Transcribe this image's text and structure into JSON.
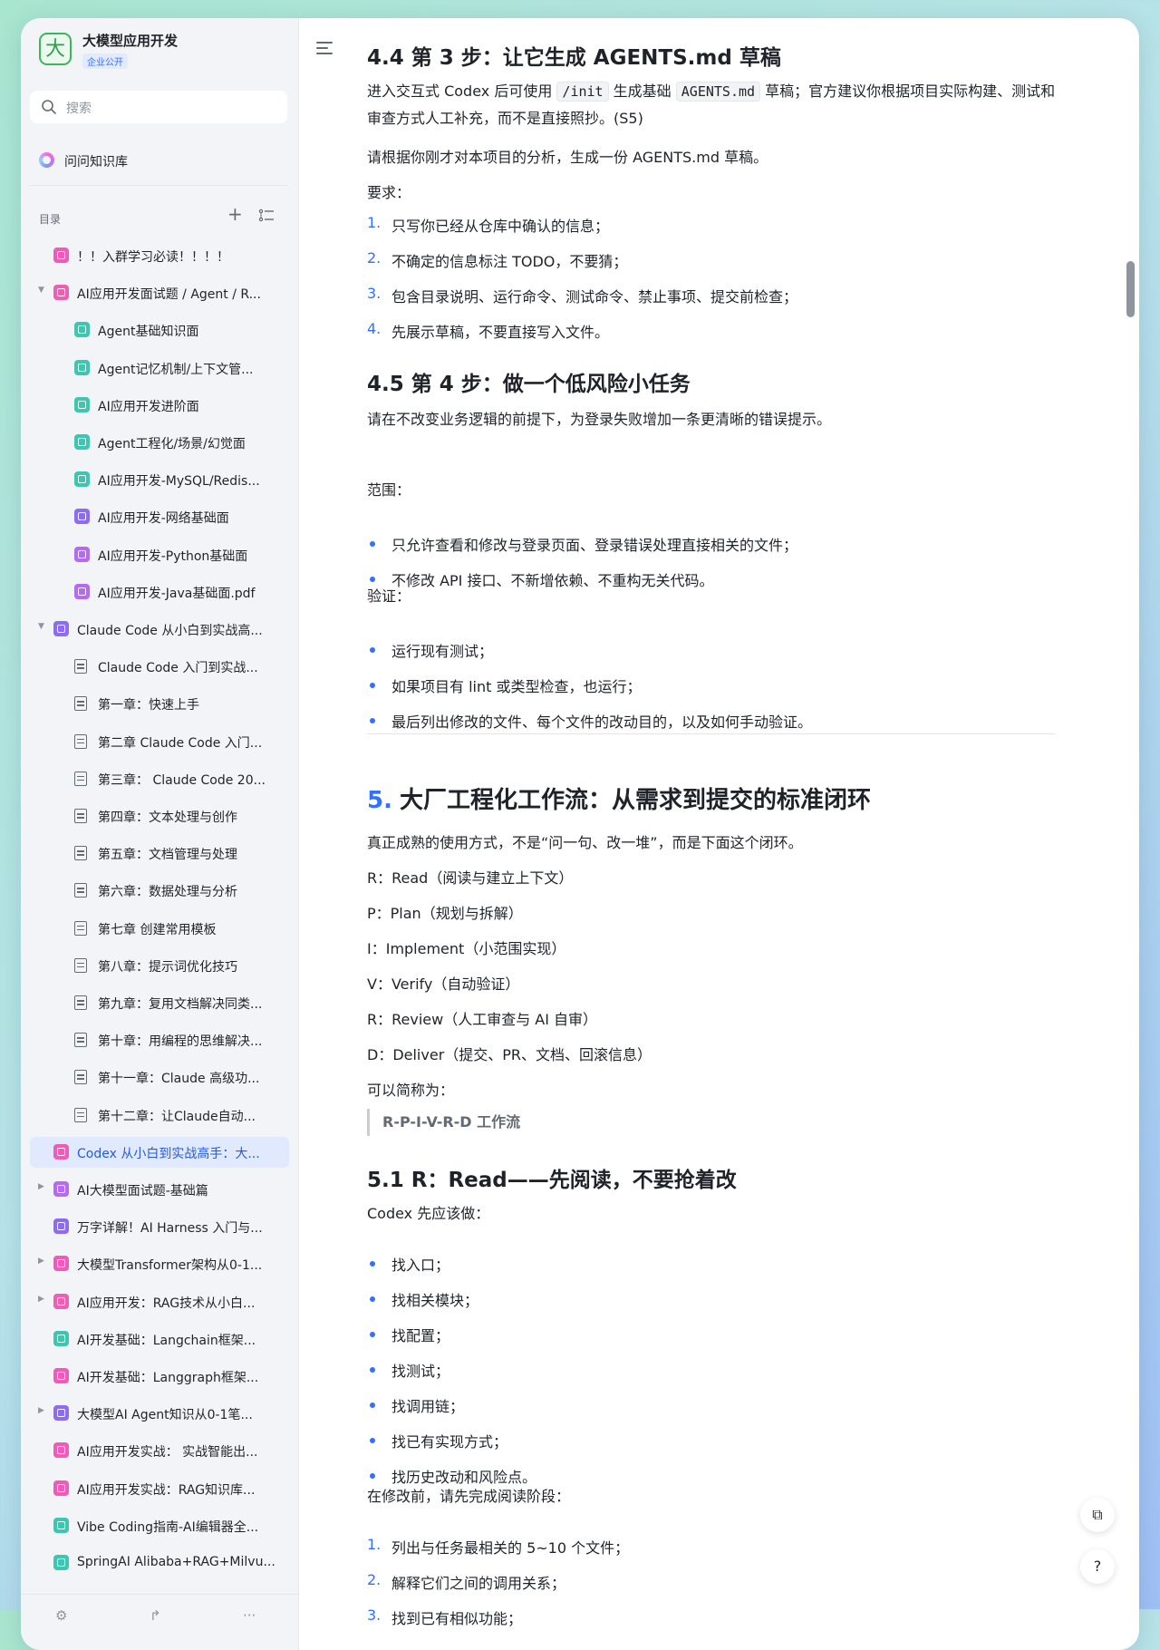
{
  "sidebar": {
    "space_logo": "大",
    "space_title": "大模型应用开发",
    "space_badge": "企业公开",
    "search_placeholder": "搜索",
    "ask_label": "问问知识库",
    "toc_heading": "目录",
    "items": [
      {
        "label": "！！入群学习必读！！！！",
        "level": 1,
        "icon": "lightning-icon",
        "color": "#f05ab8",
        "arrow": ""
      },
      {
        "label": "AI应用开发面试题 / Agent / R...",
        "level": 0,
        "icon": "folder-icon",
        "color": "#ed5fb0",
        "arrow": "expanded"
      },
      {
        "label": "Agent基础知识面",
        "level": 2,
        "icon": "bitable-icon",
        "color": "#3ec7b0",
        "arrow": ""
      },
      {
        "label": "Agent记忆机制/上下文管...",
        "level": 2,
        "icon": "bitable-icon",
        "color": "#3ec7b0",
        "arrow": ""
      },
      {
        "label": "AI应用开发进阶面",
        "level": 2,
        "icon": "bitable-icon",
        "color": "#3ec7b0",
        "arrow": ""
      },
      {
        "label": "Agent工程化/场景/幻觉面",
        "level": 2,
        "icon": "bitable-icon",
        "color": "#3ec7b0",
        "arrow": ""
      },
      {
        "label": "AI应用开发-MySQL/Redis...",
        "level": 2,
        "icon": "bitable-icon",
        "color": "#3ec7b0",
        "arrow": ""
      },
      {
        "label": "AI应用开发-网络基础面",
        "level": 2,
        "icon": "docx-icon",
        "color": "#8c6cf2",
        "arrow": ""
      },
      {
        "label": "AI应用开发-Python基础面",
        "level": 2,
        "icon": "image-icon",
        "color": "#b46bf0",
        "arrow": ""
      },
      {
        "label": "AI应用开发-Java基础面.pdf",
        "level": 2,
        "icon": "image-icon",
        "color": "#b46bf0",
        "arrow": ""
      },
      {
        "label": "Claude Code 从小白到实战高...",
        "level": 0,
        "icon": "home-icon",
        "color": "#8c6cf2",
        "arrow": "expanded"
      },
      {
        "label": "Claude Code 入门到实战...",
        "level": 2,
        "icon": "doc-icon",
        "color": "",
        "arrow": ""
      },
      {
        "label": "第一章：快速上手",
        "level": 2,
        "icon": "doc-icon",
        "color": "",
        "arrow": ""
      },
      {
        "label": "第二章 Claude Code 入门...",
        "level": 2,
        "icon": "doc-icon",
        "color": "",
        "arrow": ""
      },
      {
        "label": "第三章：  Claude Code 20...",
        "level": 2,
        "icon": "doc-icon",
        "color": "",
        "arrow": ""
      },
      {
        "label": "第四章：文本处理与创作",
        "level": 2,
        "icon": "doc-icon",
        "color": "",
        "arrow": ""
      },
      {
        "label": "第五章：文档管理与处理",
        "level": 2,
        "icon": "doc-icon",
        "color": "",
        "arrow": ""
      },
      {
        "label": "第六章：数据处理与分析",
        "level": 2,
        "icon": "doc-icon",
        "color": "",
        "arrow": ""
      },
      {
        "label": "第七章 创建常用模板",
        "level": 2,
        "icon": "doc-icon",
        "color": "",
        "arrow": ""
      },
      {
        "label": "第八章：提示词优化技巧",
        "level": 2,
        "icon": "doc-icon",
        "color": "",
        "arrow": ""
      },
      {
        "label": "第九章：复用文档解决同类...",
        "level": 2,
        "icon": "doc-icon",
        "color": "",
        "arrow": ""
      },
      {
        "label": "第十章：用编程的思维解决...",
        "level": 2,
        "icon": "doc-icon",
        "color": "",
        "arrow": ""
      },
      {
        "label": "第十一章：Claude 高级功...",
        "level": 2,
        "icon": "doc-icon",
        "color": "",
        "arrow": ""
      },
      {
        "label": "第十二章：让Claude自动...",
        "level": 2,
        "icon": "doc-icon",
        "color": "",
        "arrow": ""
      },
      {
        "label": "Codex 从小白到实战高手：大...",
        "level": 1,
        "icon": "home-icon",
        "color": "#f05ab8",
        "arrow": "",
        "active": true
      },
      {
        "label": "AI大模型面试题-基础篇",
        "level": 0,
        "icon": "image-icon",
        "color": "#b46bf0",
        "arrow": "collapsed"
      },
      {
        "label": "万字详解！AI Harness 入门与...",
        "level": 1,
        "icon": "home-icon",
        "color": "#8c6cf2",
        "arrow": ""
      },
      {
        "label": "大模型Transformer架构从0-1...",
        "level": 0,
        "icon": "image-icon",
        "color": "#f05ab8",
        "arrow": "collapsed"
      },
      {
        "label": "AI应用开发：RAG技术从小白...",
        "level": 0,
        "icon": "folder-icon",
        "color": "#ed5fb0",
        "arrow": "collapsed"
      },
      {
        "label": "AI开发基础：Langchain框架...",
        "level": 1,
        "icon": "home-icon",
        "color": "#3ec7b0",
        "arrow": ""
      },
      {
        "label": "AI开发基础：Langgraph框架...",
        "level": 1,
        "icon": "code-icon",
        "color": "#f05ab8",
        "arrow": ""
      },
      {
        "label": "大模型AI Agent知识从0-1笔...",
        "level": 0,
        "icon": "folder-icon",
        "color": "#8c6cf2",
        "arrow": "collapsed"
      },
      {
        "label": "AI应用开发实战：  实战智能出...",
        "level": 1,
        "icon": "code-icon",
        "color": "#f05ab8",
        "arrow": ""
      },
      {
        "label": "AI应用开发实战：RAG知识库...",
        "level": 1,
        "icon": "code-icon",
        "color": "#f05ab8",
        "arrow": ""
      },
      {
        "label": "Vibe Coding指南-AI编辑器全...",
        "level": 1,
        "icon": "code-icon",
        "color": "#3ec7b0",
        "arrow": ""
      },
      {
        "label": "SpringAI Alibaba+RAG+Milvu...",
        "level": 1,
        "icon": "bitable-icon",
        "color": "#3ec7b0",
        "arrow": ""
      }
    ]
  },
  "doc": {
    "s44_title": "4.4 第 3 步：让它生成 AGENTS.md 草稿",
    "s44_p1_a": "进入交互式 Codex 后可使用 ",
    "s44_p1_code1": "/init",
    "s44_p1_b": " 生成基础 ",
    "s44_p1_code2": "AGENTS.md",
    "s44_p1_c": " 草稿；官方建议你根据项目实际构建、测试和审查方式人工补充，而不是直接照抄。(S5)",
    "s44_p2": "请根据你刚才对本项目的分析，生成一份 AGENTS.md 草稿。",
    "s44_p3": "要求：",
    "s44_list": [
      "只写你已经从仓库中确认的信息；",
      "不确定的信息标注 TODO，不要猜；",
      "包含目录说明、运行命令、测试命令、禁止事项、提交前检查；",
      "先展示草稿，不要直接写入文件。"
    ],
    "s45_title": "4.5 第 4 步：做一个低风险小任务",
    "s45_p1": "请在不改变业务逻辑的前提下，为登录失败增加一条更清晰的错误提示。",
    "s45_scope": "范围：",
    "s45_scope_list": [
      "只允许查看和修改与登录页面、登录错误处理直接相关的文件；",
      "不修改 API 接口、不新增依赖、不重构无关代码。"
    ],
    "s45_verify": "验证：",
    "s45_verify_list": [
      "运行现有测试；",
      "如果项目有 lint 或类型检查，也运行；",
      "最后列出修改的文件、每个文件的改动目的，以及如何手动验证。"
    ],
    "s5_num": "5.",
    "s5_title": "大厂工程化工作流：从需求到提交的标准闭环",
    "s5_p1": "真正成熟的使用方式，不是“问一句、改一堆”，而是下面这个闭环。",
    "s5_steps": [
      "R：Read（阅读与建立上下文）",
      "P：Plan（规划与拆解）",
      "I：Implement（小范围实现）",
      "V：Verify（自动验证）",
      "R：Review（人工审查与 AI 自审）",
      "D：Deliver（提交、PR、文档、回滚信息）"
    ],
    "s5_p2": "可以简称为：",
    "s5_quote": "R-P-I-V-R-D 工作流",
    "s51_title": "5.1 R：Read——先阅读，不要抢着改",
    "s51_p1": "Codex 先应该做：",
    "s51_list": [
      "找入口；",
      "找相关模块；",
      "找配置；",
      "找测试；",
      "找调用链；",
      "找已有实现方式；",
      "找历史改动和风险点。"
    ],
    "s51_p2": "在修改前，请先完成阅读阶段：",
    "s51_olist": [
      "列出与任务最相关的 5~10 个文件；",
      "解释它们之间的调用关系；",
      "找到已有相似功能；"
    ]
  },
  "accent_color": "#3370ff",
  "active_color": "#e1e9ff"
}
